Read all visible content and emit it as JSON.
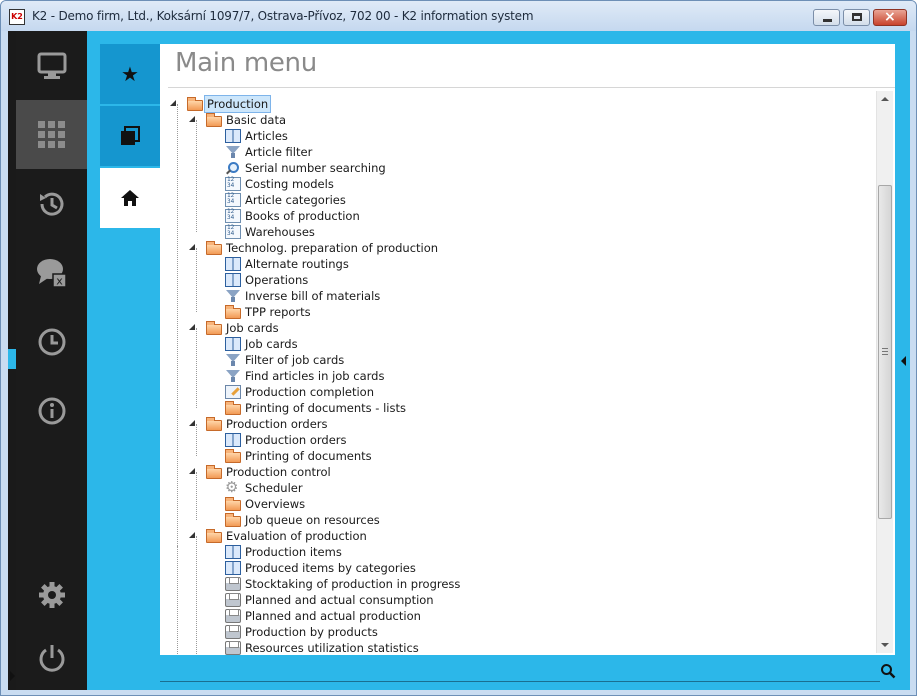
{
  "window": {
    "title": "K2 - Demo firm, Ltd., Koksární 1097/7, Ostrava-Přívoz, 702 00 - K2 information system",
    "icon_text": "K2",
    "controls": {
      "minimize": "minimize-icon",
      "maximize": "maximize-icon",
      "close": "×"
    }
  },
  "colors": {
    "accent": "#2cb7e9",
    "sidebar_bg": "#1b1b1b",
    "sidebar_active": "#4a4a4a",
    "tab_dark": "#1596cf",
    "title_text": "#8a8a8a"
  },
  "sidebar": {
    "items": [
      {
        "icon": "monitor-icon",
        "active": false
      },
      {
        "icon": "grid-icon",
        "active": true
      },
      {
        "icon": "history-icon",
        "active": false
      },
      {
        "icon": "chat-x-icon",
        "active": false,
        "badge": "x"
      },
      {
        "icon": "clock-icon",
        "active": false
      },
      {
        "icon": "info-icon",
        "active": false
      },
      {
        "icon": "gear-icon",
        "active": false
      },
      {
        "icon": "power-icon",
        "active": false
      }
    ]
  },
  "tabs": [
    {
      "icon": "star-icon",
      "label": "★"
    },
    {
      "icon": "windows-icon",
      "label": ""
    },
    {
      "icon": "home-icon",
      "label": ""
    }
  ],
  "main": {
    "title": "Main menu"
  },
  "tree": [
    {
      "label": "Production",
      "icon": "folder-icon",
      "level": 0,
      "expander": "open",
      "selected": true
    },
    {
      "label": "Basic data",
      "icon": "folder-icon",
      "level": 1,
      "expander": "open"
    },
    {
      "label": "Articles",
      "icon": "book-icon",
      "level": 2
    },
    {
      "label": "Article filter",
      "icon": "funnel-icon",
      "level": 2
    },
    {
      "label": "Serial number searching",
      "icon": "magnifier-icon",
      "level": 2
    },
    {
      "label": "Costing models",
      "icon": "sheet-icon",
      "level": 2
    },
    {
      "label": "Article categories",
      "icon": "sheet-icon",
      "level": 2
    },
    {
      "label": "Books of production",
      "icon": "sheet-icon",
      "level": 2
    },
    {
      "label": "Warehouses",
      "icon": "sheet-icon",
      "level": 2
    },
    {
      "label": "Technolog. preparation of production",
      "icon": "folder-icon",
      "level": 1,
      "expander": "open"
    },
    {
      "label": "Alternate routings",
      "icon": "book-icon",
      "level": 2
    },
    {
      "label": "Operations",
      "icon": "book-icon",
      "level": 2
    },
    {
      "label": "Inverse bill of materials",
      "icon": "funnel-icon",
      "level": 2
    },
    {
      "label": "TPP reports",
      "icon": "folder-icon",
      "level": 2,
      "expander": "closed"
    },
    {
      "label": "Job cards",
      "icon": "folder-icon",
      "level": 1,
      "expander": "open"
    },
    {
      "label": "Job cards",
      "icon": "book-icon",
      "level": 2
    },
    {
      "label": "Filter of job cards",
      "icon": "funnel-icon",
      "level": 2
    },
    {
      "label": "Find articles in job cards",
      "icon": "funnel-icon",
      "level": 2
    },
    {
      "label": "Production completion",
      "icon": "edit-icon",
      "level": 2
    },
    {
      "label": "Printing of documents - lists",
      "icon": "folder-icon",
      "level": 2,
      "expander": "closed"
    },
    {
      "label": "Production orders",
      "icon": "folder-icon",
      "level": 1,
      "expander": "open"
    },
    {
      "label": "Production orders",
      "icon": "book-icon",
      "level": 2
    },
    {
      "label": "Printing of documents",
      "icon": "folder-icon",
      "level": 2,
      "expander": "closed"
    },
    {
      "label": "Production control",
      "icon": "folder-icon",
      "level": 1,
      "expander": "open"
    },
    {
      "label": "Scheduler",
      "icon": "gear-icon",
      "level": 2
    },
    {
      "label": "Overviews",
      "icon": "folder-icon",
      "level": 2,
      "expander": "closed"
    },
    {
      "label": "Job queue on resources",
      "icon": "folder-icon",
      "level": 2,
      "expander": "closed"
    },
    {
      "label": "Evaluation of production",
      "icon": "folder-icon",
      "level": 1,
      "expander": "open"
    },
    {
      "label": "Production items",
      "icon": "book-icon",
      "level": 2
    },
    {
      "label": "Produced items by categories",
      "icon": "book-icon",
      "level": 2
    },
    {
      "label": "Stocktaking of production in progress",
      "icon": "printer-icon",
      "level": 2
    },
    {
      "label": "Planned and actual consumption",
      "icon": "printer-icon",
      "level": 2
    },
    {
      "label": "Planned and actual production",
      "icon": "printer-icon",
      "level": 2
    },
    {
      "label": "Production by products",
      "icon": "printer-icon",
      "level": 2
    },
    {
      "label": "Resources utilization statistics",
      "icon": "printer-icon",
      "level": 2
    },
    {
      "label": "",
      "icon": "printer-icon",
      "level": 2
    }
  ],
  "search": {
    "icon": "search-icon"
  }
}
